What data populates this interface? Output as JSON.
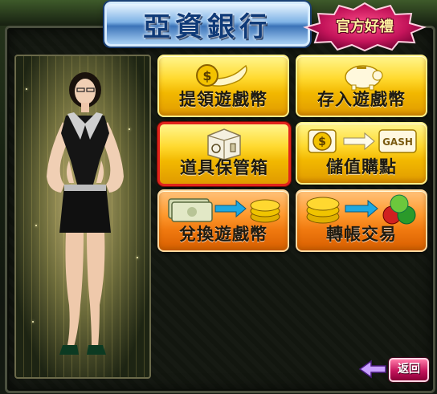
{
  "header": {
    "title": "亞資銀行",
    "gift_badge": "官方好禮"
  },
  "menu": {
    "tiles": [
      {
        "label": "提領遊戲幣",
        "icon": "coin-hand-icon"
      },
      {
        "label": "存入遊戲幣",
        "icon": "piggy-bank-icon"
      },
      {
        "label": "道具保管箱",
        "icon": "safe-icon"
      },
      {
        "label": "儲值購點",
        "icon": "coin-to-gash-icon",
        "gash_text": "GASH"
      },
      {
        "label": "兌換遊戲幣",
        "icon": "cash-to-coin-icon"
      },
      {
        "label": "轉帳交易",
        "icon": "coin-to-gems-icon"
      }
    ]
  },
  "footer": {
    "back_label": "返回"
  },
  "colors": {
    "tile_yellow": "#ffd92e",
    "tile_orange": "#f07a10",
    "selected_border": "#e0241c",
    "title_blue": "#0f3a78",
    "badge_magenta": "#c4145a"
  }
}
